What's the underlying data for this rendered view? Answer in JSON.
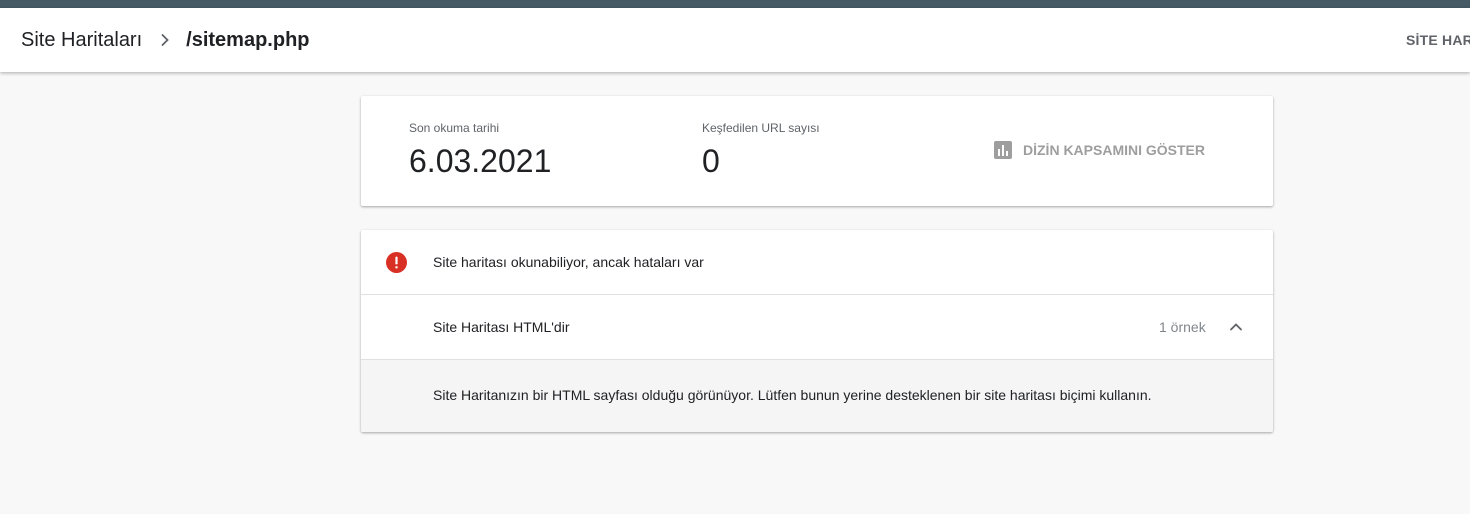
{
  "header": {
    "breadcrumb_parent": "Site Haritaları",
    "breadcrumb_current": "/sitemap.php",
    "action_label": "SİTE HARİ"
  },
  "stats": {
    "last_read_label": "Son okuma tarihi",
    "last_read_value": "6.03.2021",
    "discovered_urls_label": "Keşfedilen URL sayısı",
    "discovered_urls_value": "0",
    "coverage_button_label": "DİZİN KAPSAMINI GÖSTER",
    "coverage_icon": "bar-chart-icon"
  },
  "issues": {
    "status_icon": "error-icon",
    "status_text": "Site haritası okunabiliyor, ancak hataları var",
    "issue_title": "Site Haritası HTML'dir",
    "issue_count": "1 örnek",
    "chevron_icon": "chevron-up-icon",
    "detail_text": "Site Haritanızın bir HTML sayfası olduğu görünüyor. Lütfen bunun yerine desteklenen bir site haritası biçimi kullanın."
  },
  "colors": {
    "top_strip": "#455a64",
    "error_red": "#d93025",
    "disabled_gray": "#9e9e9e"
  }
}
